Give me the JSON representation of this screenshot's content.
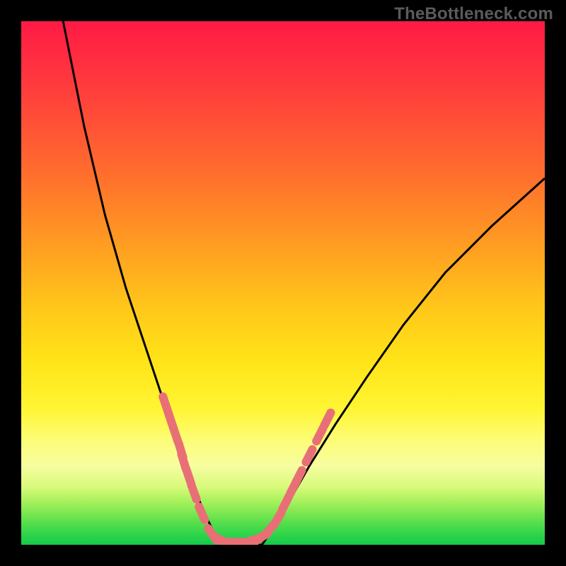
{
  "watermark": {
    "text": "TheBottleneck.com"
  },
  "chart_data": {
    "type": "line",
    "title": "",
    "xlabel": "",
    "ylabel": "",
    "xlim": [
      0,
      100
    ],
    "ylim": [
      0,
      100
    ],
    "grid": false,
    "legend": false,
    "colors": {
      "curve": "#000000",
      "markers": "#e96f77",
      "background_gradient": [
        "#ff1a45",
        "#ff6a2e",
        "#ffc81a",
        "#fff533",
        "#a3f05b",
        "#14c94a"
      ]
    },
    "series": [
      {
        "name": "left-descent",
        "x": [
          8,
          12,
          16,
          20,
          24,
          27,
          29,
          31,
          33,
          35,
          36.5,
          38
        ],
        "y": [
          100,
          80,
          63,
          49,
          37,
          28,
          22,
          17,
          11,
          6,
          3,
          0
        ]
      },
      {
        "name": "valley-floor",
        "x": [
          38,
          40,
          42,
          44,
          46
        ],
        "y": [
          0,
          0,
          0,
          0,
          0
        ]
      },
      {
        "name": "right-ascent",
        "x": [
          46,
          48,
          51,
          55,
          60,
          66,
          73,
          81,
          90,
          100
        ],
        "y": [
          0,
          3,
          8,
          15,
          23,
          32,
          42,
          52,
          61,
          70
        ]
      }
    ],
    "markers": [
      {
        "series": "left-descent",
        "x": 27.5,
        "y": 27
      },
      {
        "series": "left-descent",
        "x": 28.5,
        "y": 24
      },
      {
        "series": "left-descent",
        "x": 29.5,
        "y": 21
      },
      {
        "series": "left-descent",
        "x": 30.5,
        "y": 18
      },
      {
        "series": "left-descent",
        "x": 31.0,
        "y": 16
      },
      {
        "series": "left-descent",
        "x": 32.0,
        "y": 13
      },
      {
        "series": "left-descent",
        "x": 33.0,
        "y": 10
      },
      {
        "series": "left-descent",
        "x": 34.5,
        "y": 6
      },
      {
        "series": "valley-floor",
        "x": 36.5,
        "y": 2
      },
      {
        "series": "valley-floor",
        "x": 38.0,
        "y": 1
      },
      {
        "series": "valley-floor",
        "x": 39.5,
        "y": 0.5
      },
      {
        "series": "valley-floor",
        "x": 41.0,
        "y": 0.5
      },
      {
        "series": "valley-floor",
        "x": 43.0,
        "y": 0.5
      },
      {
        "series": "valley-floor",
        "x": 44.5,
        "y": 1
      },
      {
        "series": "valley-floor",
        "x": 46.0,
        "y": 1.5
      },
      {
        "series": "right-ascent",
        "x": 47.5,
        "y": 3
      },
      {
        "series": "right-ascent",
        "x": 49.0,
        "y": 5
      },
      {
        "series": "right-ascent",
        "x": 50.5,
        "y": 8
      },
      {
        "series": "right-ascent",
        "x": 52.0,
        "y": 11
      },
      {
        "series": "right-ascent",
        "x": 53.0,
        "y": 13
      },
      {
        "series": "right-ascent",
        "x": 55.0,
        "y": 17
      },
      {
        "series": "right-ascent",
        "x": 57.0,
        "y": 21
      },
      {
        "series": "right-ascent",
        "x": 58.5,
        "y": 24
      }
    ]
  }
}
